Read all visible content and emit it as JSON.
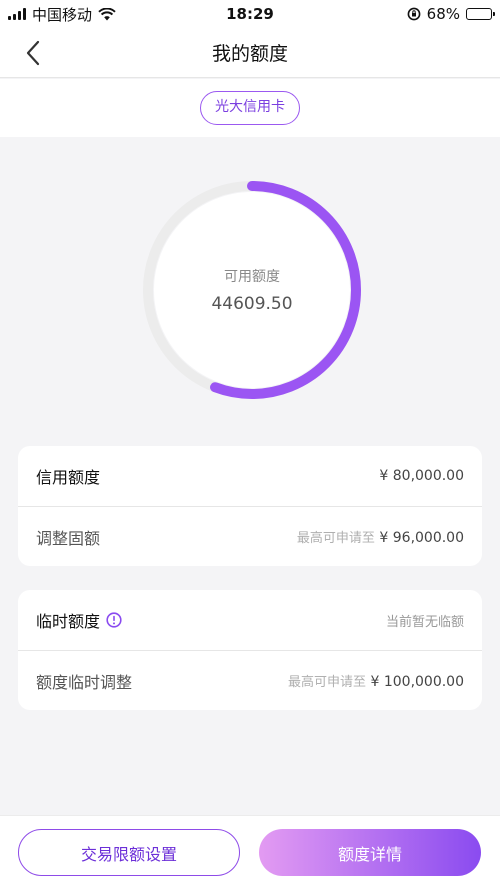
{
  "status_bar": {
    "carrier": "中国移动",
    "time": "18:29",
    "battery": "68%",
    "battery_level": 0.68
  },
  "nav": {
    "title": "我的额度",
    "back_icon": "chevron-left-icon"
  },
  "card_tab": {
    "label": "光大信用卡"
  },
  "quota_ring": {
    "label": "可用额度",
    "value": "44609.50",
    "progress": 0.5576,
    "track_color": "#ececec",
    "arc_color": "#9b55f3"
  },
  "credit_panel": {
    "rows": [
      {
        "label": "信用额度",
        "hint": "",
        "value": "¥ 80,000.00"
      },
      {
        "label": "调整固额",
        "hint": "最高可申请至",
        "value": "¥ 96,000.00"
      }
    ]
  },
  "temp_panel": {
    "rows": [
      {
        "label": "临时额度",
        "value": "当前暂无临额",
        "icon": "info-circle-icon"
      },
      {
        "label": "额度临时调整",
        "hint": "最高可申请至",
        "value": "¥ 100,000.00"
      }
    ]
  },
  "bottom": {
    "left_button": "交易限额设置",
    "right_button": "额度详情"
  },
  "colors": {
    "accent": "#8a4bf0",
    "accent_light": "#e39bf2"
  }
}
